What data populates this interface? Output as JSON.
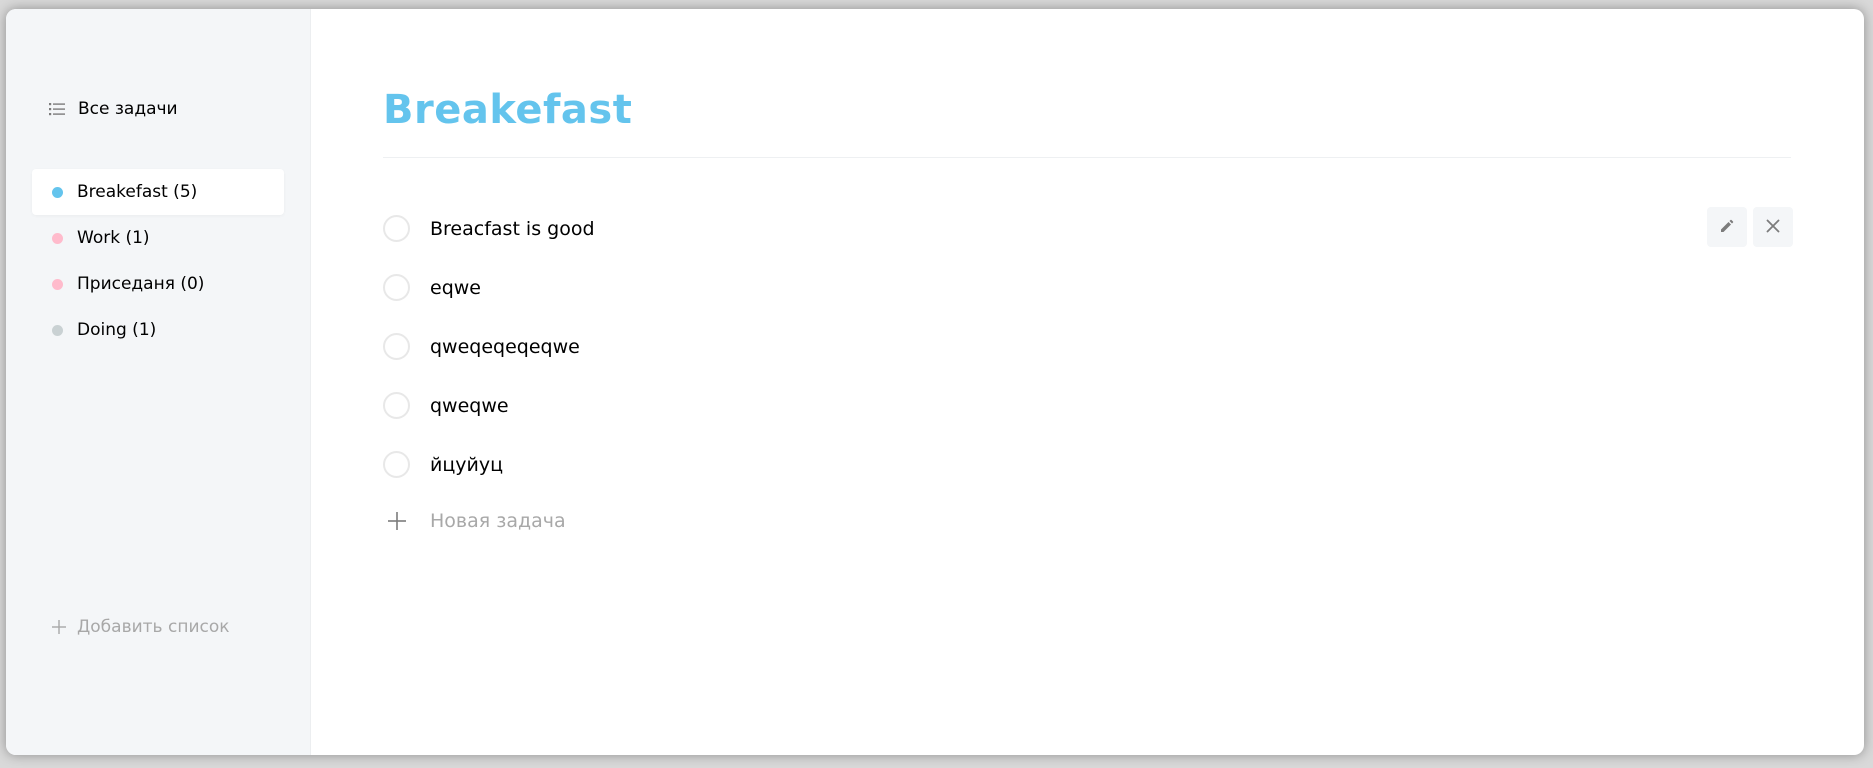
{
  "sidebar": {
    "all_tasks": {
      "label": "Все задачи",
      "icon": "list-icon"
    },
    "lists": [
      {
        "label": "Breakefast (5)",
        "color": "#64c4ed",
        "active": true
      },
      {
        "label": "Work (1)",
        "color": "#ffbbcc",
        "active": false
      },
      {
        "label": "Приседаня (0)",
        "color": "#ffbbcc",
        "active": false
      },
      {
        "label": "Doing (1)",
        "color": "#c9d1d3",
        "active": false
      }
    ],
    "add_list": {
      "label": "Добавить список",
      "icon": "plus-icon"
    }
  },
  "main": {
    "title": "Breakefast",
    "title_color": "#64c4ed",
    "tasks": [
      {
        "text": "Breacfast is good"
      },
      {
        "text": "eqwe"
      },
      {
        "text": "qweqeqeqeqwe"
      },
      {
        "text": "qweqwe"
      },
      {
        "text": "йцуйуц"
      }
    ],
    "task_actions": {
      "edit_icon": "pencil-icon",
      "delete_icon": "close-icon"
    },
    "new_task": {
      "label": "Новая задача",
      "icon": "plus-icon"
    }
  }
}
